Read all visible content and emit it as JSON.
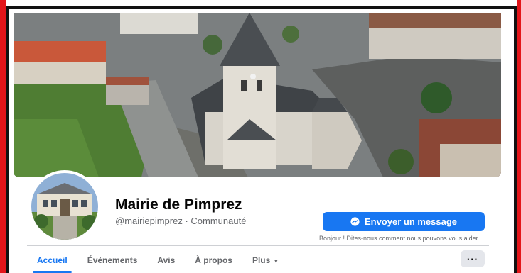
{
  "page": {
    "name": "Mairie de Pimprez",
    "subtitle": "@mairiepimprez · Communauté"
  },
  "actions": {
    "message_label": "Envoyer un message",
    "helper_text": "Bonjour ! Dites-nous comment nous pouvons vous aider.",
    "more_label": "···"
  },
  "tabs": [
    {
      "label": "Accueil",
      "active": true
    },
    {
      "label": "Évènements",
      "active": false
    },
    {
      "label": "Avis",
      "active": false
    },
    {
      "label": "À propos",
      "active": false
    },
    {
      "label": "Plus",
      "active": false,
      "has_caret": true
    }
  ],
  "icons": {
    "messenger": "messenger-icon",
    "caret": "caret-down-icon"
  },
  "colors": {
    "accent": "#1877f2",
    "frame_red": "#e3151a",
    "frame_black": "#111111",
    "headline_blue": "#1f2ad8"
  }
}
